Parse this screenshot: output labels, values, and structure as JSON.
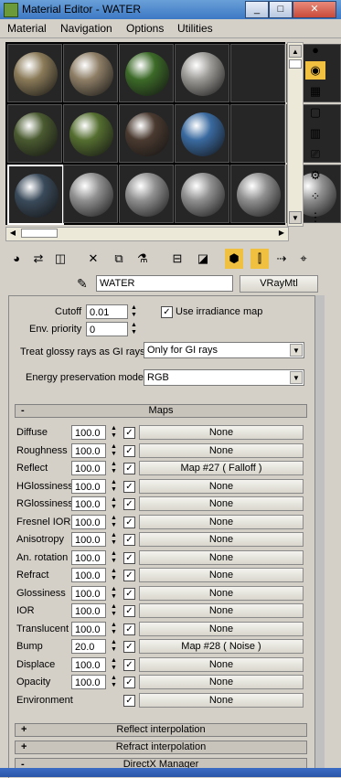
{
  "window": {
    "title": "Material Editor - WATER"
  },
  "window_buttons": [
    "_",
    "□",
    "✕"
  ],
  "menu": [
    "Material",
    "Navigation",
    "Options",
    "Utilities"
  ],
  "material": {
    "name": "WATER",
    "type": "VRayMtl"
  },
  "basic": {
    "cutoff_label": "Cutoff",
    "cutoff_value": "0.01",
    "irradiance_label": "Use irradiance map",
    "irradiance_checked": true,
    "env_priority_label": "Env. priority",
    "env_priority_value": "0",
    "glossy_gi_label": "Treat glossy rays as GI rays:",
    "glossy_gi_value": "Only for GI rays",
    "energy_label": "Energy preservation mode:",
    "energy_value": "RGB"
  },
  "maps": {
    "title": "Maps",
    "sign": "-",
    "rows": [
      {
        "label": "Diffuse",
        "amount": "100.0",
        "checked": true,
        "map": "None"
      },
      {
        "label": "Roughness",
        "amount": "100.0",
        "checked": true,
        "map": "None"
      },
      {
        "label": "Reflect",
        "amount": "100.0",
        "checked": true,
        "map": "Map #27  ( Falloff )"
      },
      {
        "label": "HGlossiness",
        "amount": "100.0",
        "checked": true,
        "map": "None"
      },
      {
        "label": "RGlossiness",
        "amount": "100.0",
        "checked": true,
        "map": "None"
      },
      {
        "label": "Fresnel IOR",
        "amount": "100.0",
        "checked": true,
        "map": "None"
      },
      {
        "label": "Anisotropy",
        "amount": "100.0",
        "checked": true,
        "map": "None"
      },
      {
        "label": "An. rotation",
        "amount": "100.0",
        "checked": true,
        "map": "None"
      },
      {
        "label": "Refract",
        "amount": "100.0",
        "checked": true,
        "map": "None"
      },
      {
        "label": "Glossiness",
        "amount": "100.0",
        "checked": true,
        "map": "None"
      },
      {
        "label": "IOR",
        "amount": "100.0",
        "checked": true,
        "map": "None"
      },
      {
        "label": "Translucent",
        "amount": "100.0",
        "checked": true,
        "map": "None"
      },
      {
        "label": "Bump",
        "amount": "20.0",
        "checked": true,
        "map": "Map #28  ( Noise )"
      },
      {
        "label": "Displace",
        "amount": "100.0",
        "checked": true,
        "map": "None"
      },
      {
        "label": "Opacity",
        "amount": "100.0",
        "checked": true,
        "map": "None"
      },
      {
        "label": "Environment",
        "amount": "",
        "checked": true,
        "map": "None"
      }
    ]
  },
  "rollouts": [
    {
      "sign": "+",
      "title": "Reflect interpolation"
    },
    {
      "sign": "+",
      "title": "Refract interpolation"
    },
    {
      "sign": "-",
      "title": "DirectX Manager"
    }
  ],
  "slot_colors": [
    [
      "#8a7a58",
      "#8e7e66",
      "#3c6a28",
      "#9c9a96",
      "#262626",
      "#262626"
    ],
    [
      "#4a5a30",
      "#556e30",
      "#4a3a30",
      "#3a6aa0",
      "#262626",
      "#262626"
    ],
    [
      "#3a4a5a",
      "#909090",
      "#909090",
      "#909090",
      "#909090",
      "#909090"
    ]
  ]
}
